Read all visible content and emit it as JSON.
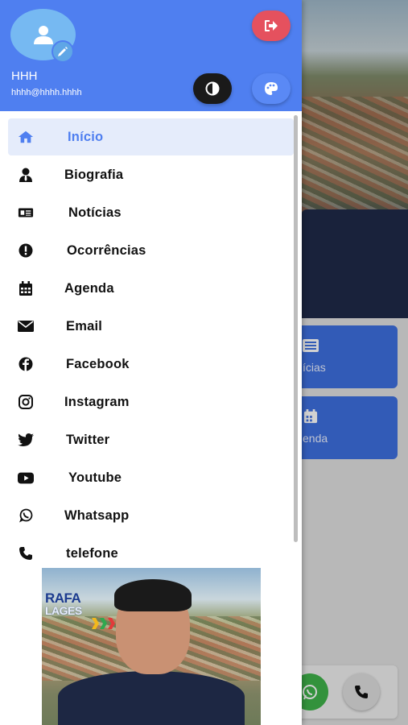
{
  "user": {
    "name": "HHH",
    "email": "hhhh@hhhh.hhhh"
  },
  "header_buttons": [
    {
      "name": "logout",
      "icon": "sign-out-icon",
      "color": "#e5515e"
    },
    {
      "name": "contrast",
      "icon": "contrast-icon",
      "color": "#1a1a1a"
    },
    {
      "name": "palette",
      "icon": "palette-icon",
      "color": "#5a89f5"
    }
  ],
  "menu": {
    "items": [
      {
        "label": "Início",
        "icon": "home-icon",
        "active": true
      },
      {
        "label": "Biografia",
        "icon": "user-tie-icon"
      },
      {
        "label": "Notícias",
        "icon": "newspaper-icon"
      },
      {
        "label": "Ocorrências",
        "icon": "alert-icon"
      },
      {
        "label": "Agenda",
        "icon": "calendar-icon"
      },
      {
        "label": "Email",
        "icon": "envelope-icon"
      },
      {
        "label": "Facebook",
        "icon": "facebook-icon"
      },
      {
        "label": "Instagram",
        "icon": "instagram-icon"
      },
      {
        "label": "Twitter",
        "icon": "twitter-icon"
      },
      {
        "label": "Youtube",
        "icon": "youtube-icon"
      },
      {
        "label": "Whatsapp",
        "icon": "whatsapp-icon"
      },
      {
        "label": "telefone",
        "icon": "phone-icon"
      }
    ]
  },
  "banner": {
    "logo_top": "RAFA",
    "logo_bottom": "LAGES"
  },
  "background": {
    "tiles": [
      {
        "label": "ícias",
        "icon": "newspaper-icon"
      },
      {
        "label": "enda",
        "icon": "calendar-icon"
      }
    ]
  },
  "colors": {
    "primary": "#4f7ff0",
    "active_bg": "#e5ecfb",
    "danger": "#e5515e",
    "whatsapp": "#3fb24a"
  }
}
